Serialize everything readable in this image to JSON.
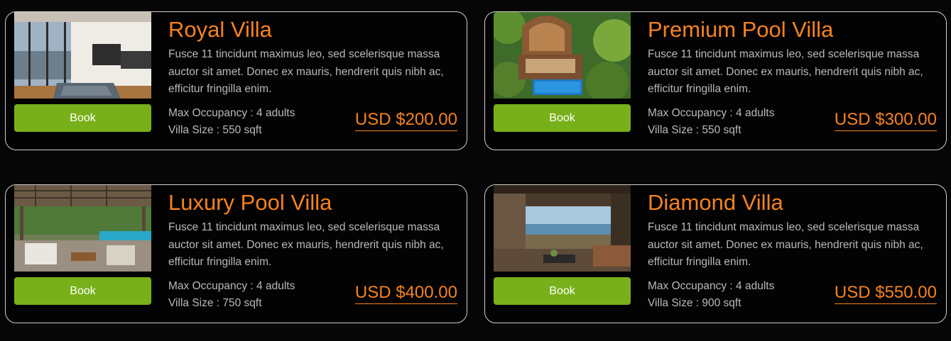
{
  "villas": [
    {
      "name": "Royal Villa",
      "description": "Fusce 11 tincidunt maximus leo, sed scelerisque massa auctor sit amet. Donec ex mauris, hendrerit quis nibh ac, efficitur fringilla enim.",
      "occupancy": "Max Occupancy : 4 adults",
      "size": "Villa Size : 550 sqft",
      "currency": "USD",
      "price": "$200.00",
      "book_label": "Book",
      "image_icon": "villa-interior-photo"
    },
    {
      "name": "Premium Pool Villa",
      "description": "Fusce 11 tincidunt maximus leo, sed scelerisque massa auctor sit amet. Donec ex mauris, hendrerit quis nibh ac, efficitur fringilla enim.",
      "occupancy": "Max Occupancy : 4 adults",
      "size": "Villa Size : 550 sqft",
      "currency": "USD",
      "price": "$300.00",
      "book_label": "Book",
      "image_icon": "pool-villa-aerial-photo"
    },
    {
      "name": "Luxury Pool Villa",
      "description": "Fusce 11 tincidunt maximus leo, sed scelerisque massa auctor sit amet. Donec ex mauris, hendrerit quis nibh ac, efficitur fringilla enim.",
      "occupancy": "Max Occupancy : 4 adults",
      "size": "Villa Size : 750 sqft",
      "currency": "USD",
      "price": "$400.00",
      "book_label": "Book",
      "image_icon": "pergola-pool-photo"
    },
    {
      "name": "Diamond Villa",
      "description": "Fusce 11 tincidunt maximus leo, sed scelerisque massa auctor sit amet. Donec ex mauris, hendrerit quis nibh ac, efficitur fringilla enim.",
      "occupancy": "Max Occupancy : 4 adults",
      "size": "Villa Size : 900 sqft",
      "currency": "USD",
      "price": "$550.00",
      "book_label": "Book",
      "image_icon": "ocean-view-lounge-photo"
    }
  ],
  "colors": {
    "accent": "#f58220",
    "button": "#78b01a",
    "background": "#060606",
    "text_muted": "#b9b9b9",
    "card_border": "#cfcfcf"
  }
}
